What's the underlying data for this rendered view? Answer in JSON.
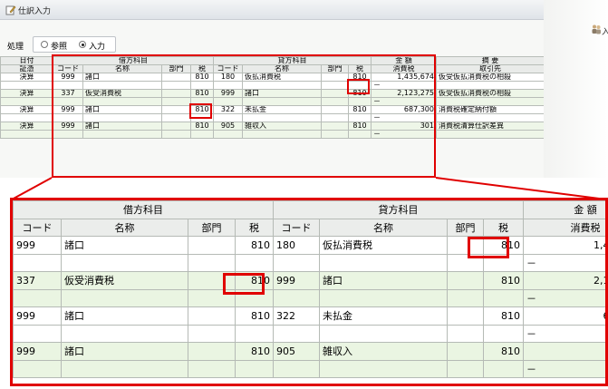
{
  "window": {
    "title": "仕訳入力",
    "tool_label": "入"
  },
  "mode": {
    "label": "処理",
    "options": [
      "参照",
      "入力"
    ],
    "selected": 1
  },
  "small_headers": {
    "row1": [
      "日付",
      "借方科目",
      "貸方科目",
      "金 額",
      "摘 要"
    ],
    "row2": [
      "証憑",
      "コード",
      "名称",
      "部門",
      "税",
      "コード",
      "名称",
      "部門",
      "税",
      "消費税",
      "取引先"
    ]
  },
  "entries": [
    {
      "date": "決算",
      "dr_code": "999",
      "dr_name": "諸口",
      "dr_dept": "",
      "dr_tax": "810",
      "cr_code": "180",
      "cr_name": "仮払消費税",
      "cr_dept": "",
      "cr_tax": "810",
      "amount": "1,435,674",
      "amount_sub": "－",
      "memo": "仮受仮払消費税の相殺"
    },
    {
      "date": "決算",
      "dr_code": "337",
      "dr_name": "仮受消費税",
      "dr_dept": "",
      "dr_tax": "810",
      "cr_code": "999",
      "cr_name": "諸口",
      "cr_dept": "",
      "cr_tax": "810",
      "amount": "2,123,275",
      "amount_sub": "－",
      "memo": "仮受仮払消費税の相殺"
    },
    {
      "date": "決算",
      "dr_code": "999",
      "dr_name": "諸口",
      "dr_dept": "",
      "dr_tax": "810",
      "cr_code": "322",
      "cr_name": "未払金",
      "cr_dept": "",
      "cr_tax": "810",
      "amount": "687,300",
      "amount_sub": "－",
      "memo": "消費税確定納付額"
    },
    {
      "date": "決算",
      "dr_code": "999",
      "dr_name": "諸口",
      "dr_dept": "",
      "dr_tax": "810",
      "cr_code": "905",
      "cr_name": "雑収入",
      "cr_dept": "",
      "cr_tax": "810",
      "amount": "301",
      "amount_sub": "－",
      "memo": "消費税清算仕訳差異"
    }
  ],
  "zoom_headers": {
    "row1": [
      "借方科目",
      "貸方科目",
      "金 額"
    ],
    "row2": [
      "コード",
      "名称",
      "部門",
      "税",
      "コード",
      "名称",
      "部門",
      "税",
      "消費税"
    ]
  },
  "colors": {
    "highlight": "#e00000",
    "alt_row": "#eaf5e2",
    "header_bg": "#ebedeb"
  }
}
